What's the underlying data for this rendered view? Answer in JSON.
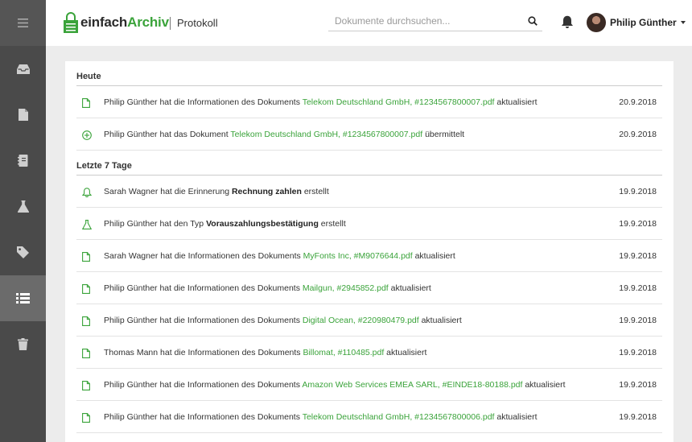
{
  "app": {
    "logo_prefix": "einfach",
    "logo_accent": "Archiv",
    "page_title": "Protokoll"
  },
  "search": {
    "placeholder": "Dokumente durchsuchen..."
  },
  "user": {
    "name": "Philip Günther"
  },
  "sidebar": {
    "items": [
      {
        "icon": "menu-icon"
      },
      {
        "icon": "inbox-icon"
      },
      {
        "icon": "document-icon"
      },
      {
        "icon": "notebook-icon"
      },
      {
        "icon": "flask-icon"
      },
      {
        "icon": "tag-icon"
      },
      {
        "icon": "list-icon",
        "active": true
      },
      {
        "icon": "trash-icon"
      }
    ]
  },
  "colors": {
    "accent": "#3aa33a",
    "sidebar": "#4a4a4a",
    "sidebar_active": "#6b6b6b"
  },
  "sections": [
    {
      "title": "Heute",
      "entries": [
        {
          "icon": "document-icon",
          "pre": "Philip Günther hat die Informationen des Dokuments ",
          "link": "Telekom Deutschland GmbH, #1234567800007.pdf",
          "bold": "",
          "post": " aktualisiert",
          "date": "20.9.2018"
        },
        {
          "icon": "plus-circle-icon",
          "pre": "Philip Günther hat das Dokument ",
          "link": "Telekom Deutschland GmbH, #1234567800007.pdf",
          "bold": "",
          "post": " übermittelt",
          "date": "20.9.2018"
        }
      ]
    },
    {
      "title": "Letzte 7 Tage",
      "entries": [
        {
          "icon": "bell-icon",
          "pre": "Sarah Wagner hat die Erinnerung ",
          "link": "",
          "bold": "Rechnung zahlen",
          "post": " erstellt",
          "date": "19.9.2018"
        },
        {
          "icon": "flask-icon",
          "pre": "Philip Günther hat den Typ ",
          "link": "",
          "bold": "Vorauszahlungsbestätigung",
          "post": " erstellt",
          "date": "19.9.2018"
        },
        {
          "icon": "document-icon",
          "pre": "Sarah Wagner hat die Informationen des Dokuments ",
          "link": "MyFonts Inc, #M9076644.pdf",
          "bold": "",
          "post": " aktualisiert",
          "date": "19.9.2018"
        },
        {
          "icon": "document-icon",
          "pre": "Philip Günther hat die Informationen des Dokuments ",
          "link": "Mailgun, #2945852.pdf",
          "bold": "",
          "post": " aktualisiert",
          "date": "19.9.2018"
        },
        {
          "icon": "document-icon",
          "pre": "Philip Günther hat die Informationen des Dokuments ",
          "link": "Digital Ocean, #220980479.pdf",
          "bold": "",
          "post": " aktualisiert",
          "date": "19.9.2018"
        },
        {
          "icon": "document-icon",
          "pre": "Thomas Mann hat die Informationen des Dokuments ",
          "link": "Billomat, #110485.pdf",
          "bold": "",
          "post": " aktualisiert",
          "date": "19.9.2018"
        },
        {
          "icon": "document-icon",
          "pre": "Philip Günther hat die Informationen des Dokuments ",
          "link": "Amazon Web Services EMEA SARL, #EINDE18-80188.pdf",
          "bold": "",
          "post": " aktualisiert",
          "date": "19.9.2018"
        },
        {
          "icon": "document-icon",
          "pre": "Philip Günther hat die Informationen des Dokuments ",
          "link": "Telekom Deutschland GmbH, #1234567800006.pdf",
          "bold": "",
          "post": " aktualisiert",
          "date": "19.9.2018"
        }
      ]
    }
  ]
}
